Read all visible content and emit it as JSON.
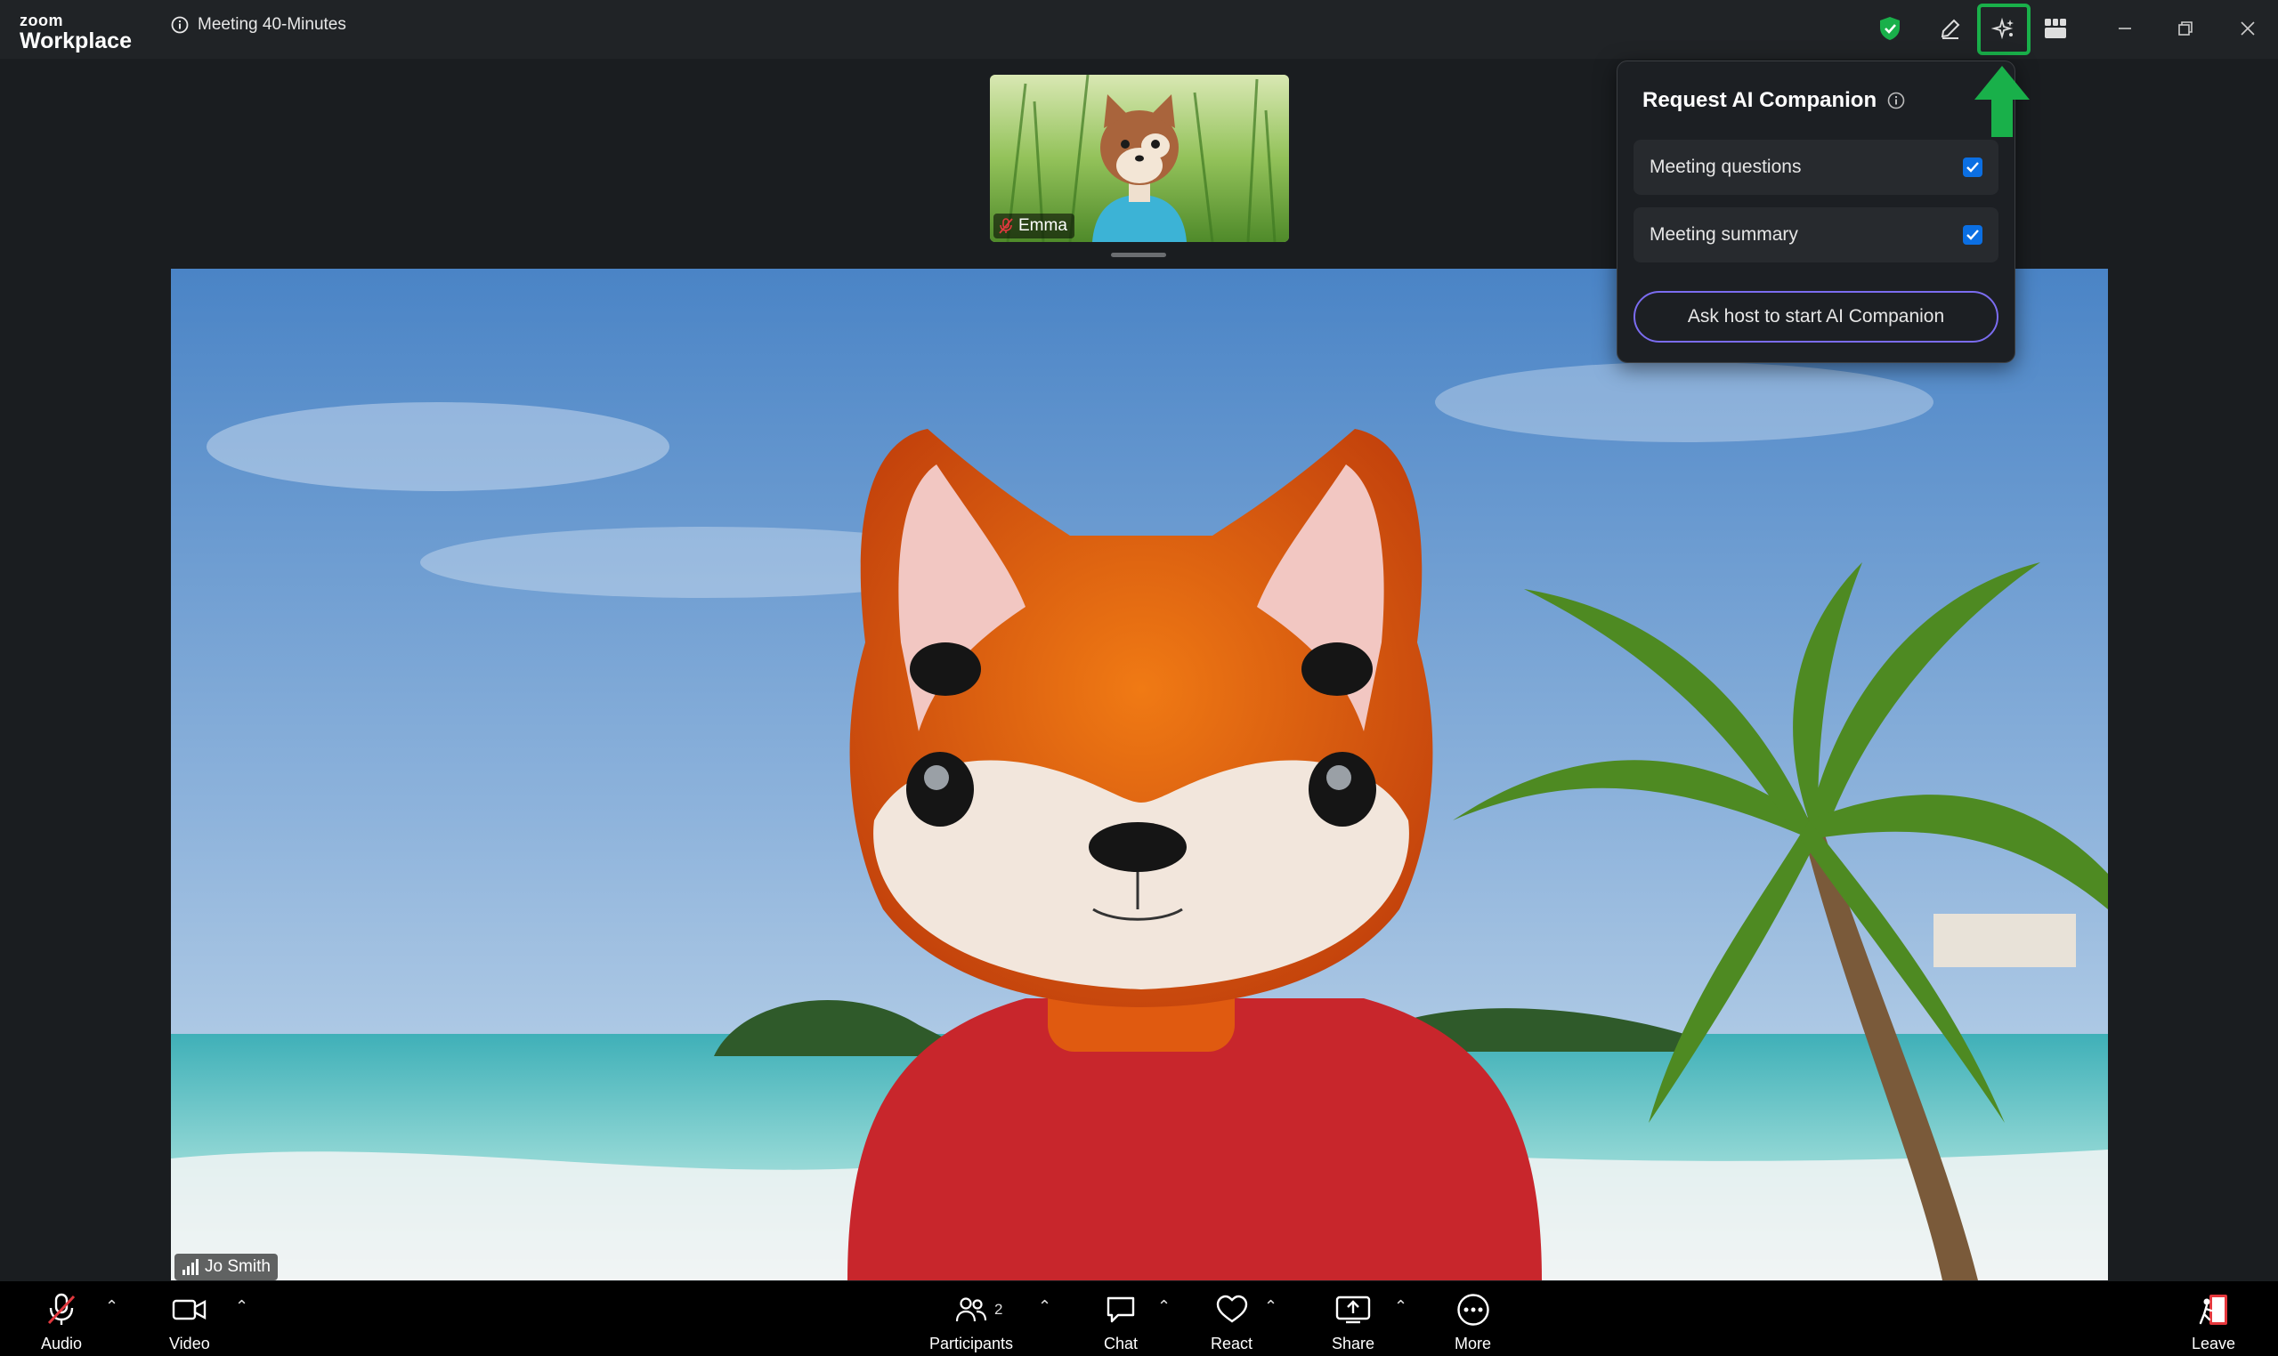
{
  "app": {
    "brand_small": "zoom",
    "brand_large": "Workplace",
    "meeting_title": "Meeting 40-Minutes"
  },
  "icons": {
    "security": "shield-check-icon",
    "annotate": "pencil-icon",
    "ai_companion": "sparkle-icon",
    "view": "grid-view-icon",
    "minimize": "minimize-icon",
    "restore": "restore-icon",
    "close": "close-icon"
  },
  "thumbnail": {
    "participant_name": "Emma",
    "muted": true
  },
  "main": {
    "participant_name": "Jo Smith"
  },
  "ai_popover": {
    "title": "Request AI Companion",
    "options": [
      {
        "label": "Meeting questions",
        "checked": true
      },
      {
        "label": "Meeting summary",
        "checked": true
      }
    ],
    "ask_button": "Ask host to start AI Companion"
  },
  "toolbar": {
    "audio": "Audio",
    "video": "Video",
    "participants": "Participants",
    "participants_count": "2",
    "chat": "Chat",
    "react": "React",
    "share": "Share",
    "more": "More",
    "leave": "Leave"
  },
  "colors": {
    "accent_green": "#19b04a",
    "checkbox_blue": "#0b6fe3",
    "leave_red": "#e5373c",
    "mute_red": "#e0383e"
  }
}
